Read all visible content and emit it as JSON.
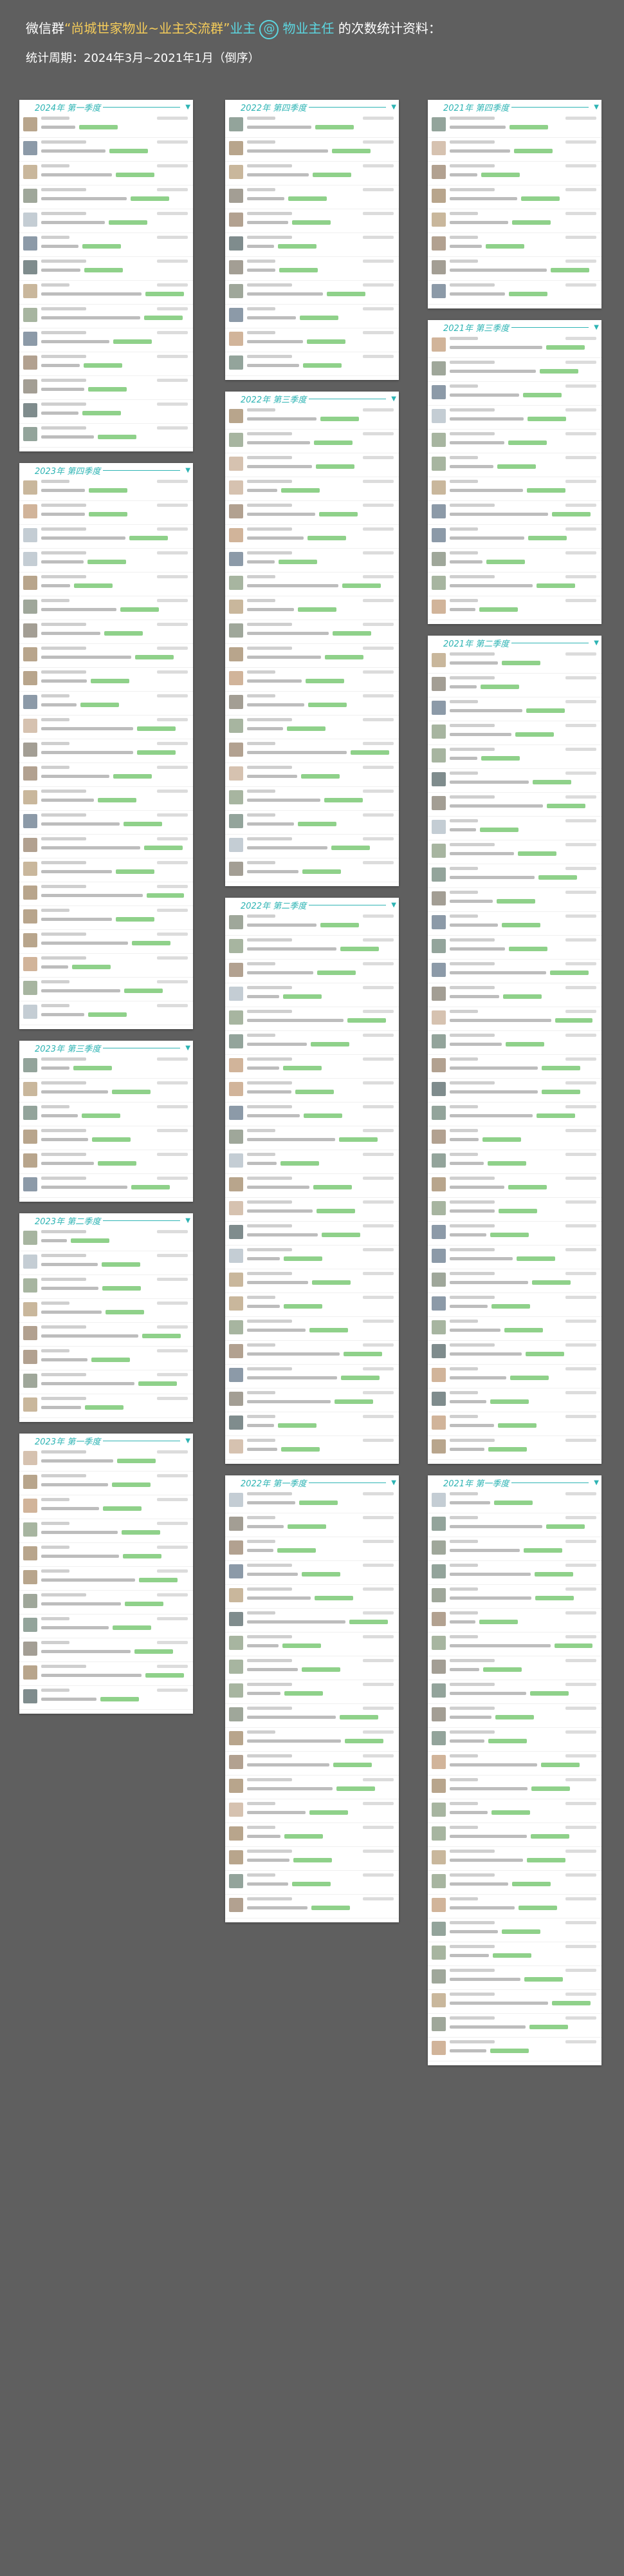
{
  "header": {
    "title_prefix": "微信群",
    "group_name": "“尚城世家物业~业主交流群”",
    "subject": "业主",
    "at_symbol": "@",
    "target": "物业主任",
    "title_suffix": "的次数统计资料：",
    "period": "统计周期：2024年3月~2021年1月（倒序）"
  },
  "colors": {
    "background": "#5f5f5f",
    "accent": "#2eb4b4",
    "highlight": "#f5cc5a",
    "mention": "#8fd18a"
  },
  "columns": [
    {
      "cards": [
        {
          "label": "2024年 第一季度",
          "count": 14
        },
        {
          "label": "2023年 第四季度",
          "count": 23
        },
        {
          "label": "2023年 第三季度",
          "count": 6
        },
        {
          "label": "2023年 第二季度",
          "count": 8
        },
        {
          "label": "2023年 第一季度",
          "count": 11
        }
      ]
    },
    {
      "cards": [
        {
          "label": "2022年 第四季度",
          "count": 11
        },
        {
          "label": "2022年 第三季度",
          "count": 20
        },
        {
          "label": "2022年 第二季度",
          "count": 23
        },
        {
          "label": "2022年 第一季度",
          "count": 18
        }
      ]
    },
    {
      "cards": [
        {
          "label": "2021年 第四季度",
          "count": 8
        },
        {
          "label": "2021年 第三季度",
          "count": 12
        },
        {
          "label": "2021年 第二季度",
          "count": 34
        },
        {
          "label": "2021年 第一季度",
          "count": 24
        }
      ]
    }
  ]
}
